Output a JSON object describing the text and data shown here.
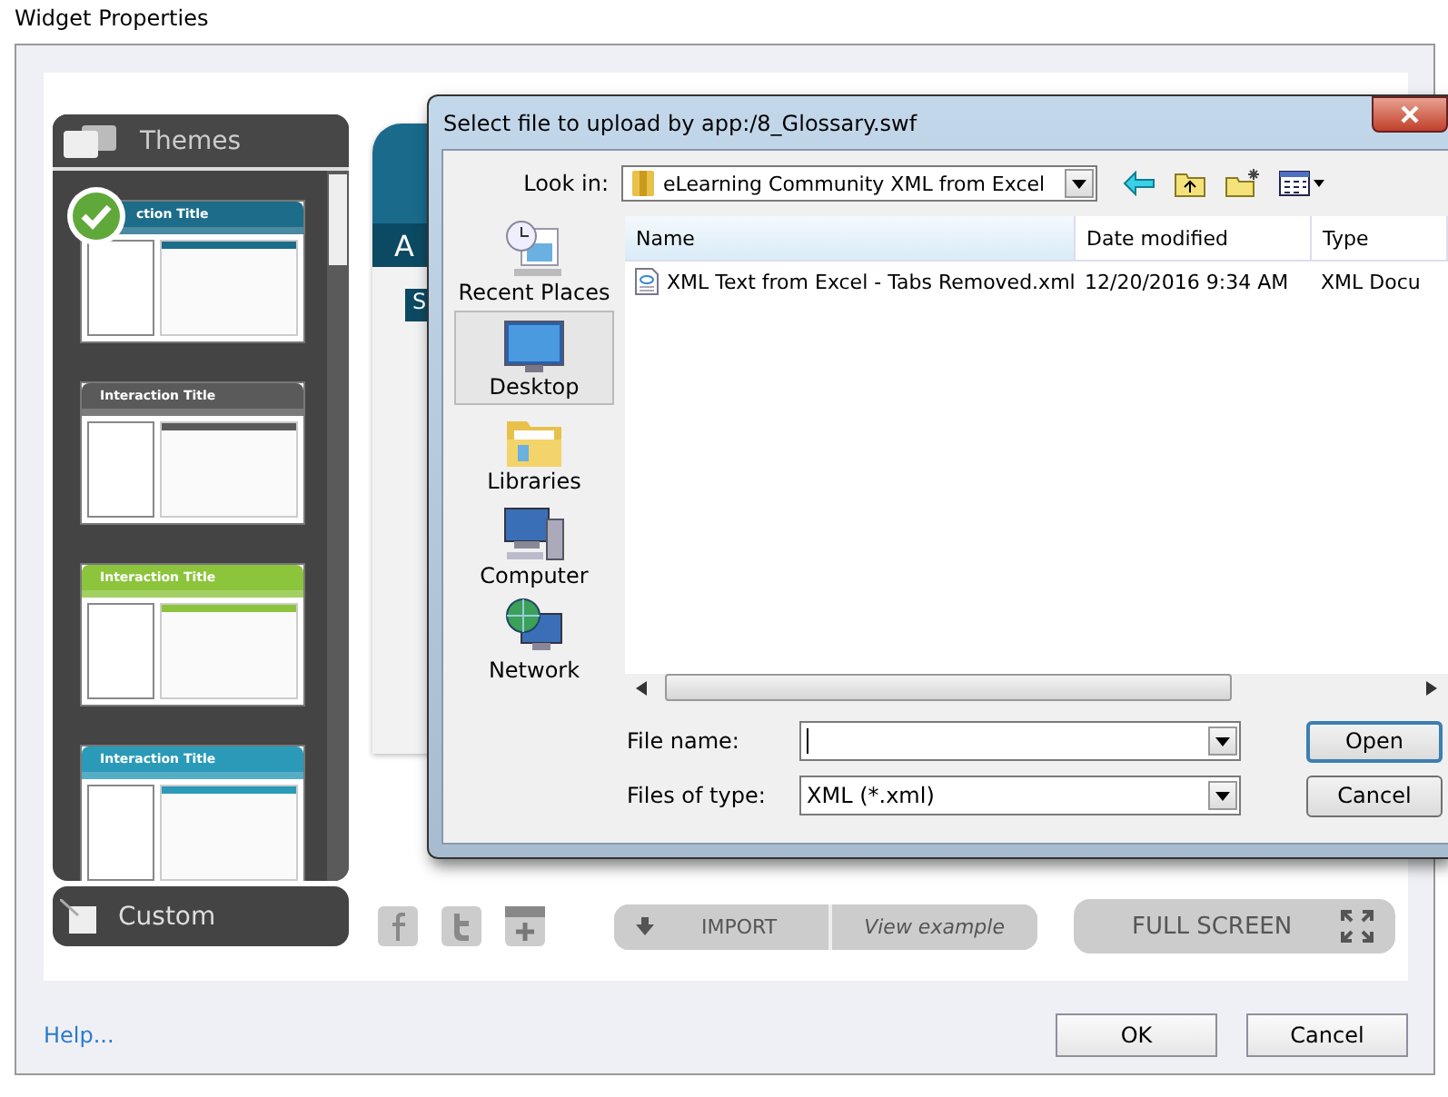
{
  "window": {
    "title": "Widget Properties"
  },
  "themes": {
    "title": "Themes",
    "items": [
      {
        "title": "ction Title",
        "selected": true,
        "color": "#1c6c8a"
      },
      {
        "title": "Interaction Title",
        "selected": false,
        "color": "#5a5a5a"
      },
      {
        "title": "Interaction Title",
        "selected": false,
        "color": "#8cc43c"
      },
      {
        "title": "Interaction Title",
        "selected": false,
        "color": "#2a9ab8"
      }
    ]
  },
  "custom": "Custom",
  "preview": {
    "tab": "A",
    "section": "S"
  },
  "import": {
    "label": "IMPORT",
    "example": "View example"
  },
  "fullscreen": "FULL SCREEN",
  "dialog": {
    "title": "Select file to upload by app:/8_Glossary.swf",
    "look_in_label": "Look in:",
    "look_in": "eLearning Community XML from Excel",
    "places": [
      {
        "label": "Recent Places",
        "kind": "recent",
        "selected": false
      },
      {
        "label": "Desktop",
        "kind": "desktop",
        "selected": true
      },
      {
        "label": "Libraries",
        "kind": "libraries",
        "selected": false
      },
      {
        "label": "Computer",
        "kind": "computer",
        "selected": false
      },
      {
        "label": "Network",
        "kind": "network",
        "selected": false
      }
    ],
    "columns": [
      "Name",
      "Date modified",
      "Type"
    ],
    "files": [
      {
        "name": "XML Text from Excel - Tabs Removed.xml",
        "date": "12/20/2016 9:34 AM",
        "type": "XML Docu"
      }
    ],
    "file_name_label": "File name:",
    "type_label": "Files of type:",
    "type_value": "XML (*.xml)",
    "buttons": [
      "Open",
      "Cancel"
    ]
  },
  "footer": {
    "help": "Help...",
    "buttons": [
      "OK",
      "Cancel"
    ]
  }
}
